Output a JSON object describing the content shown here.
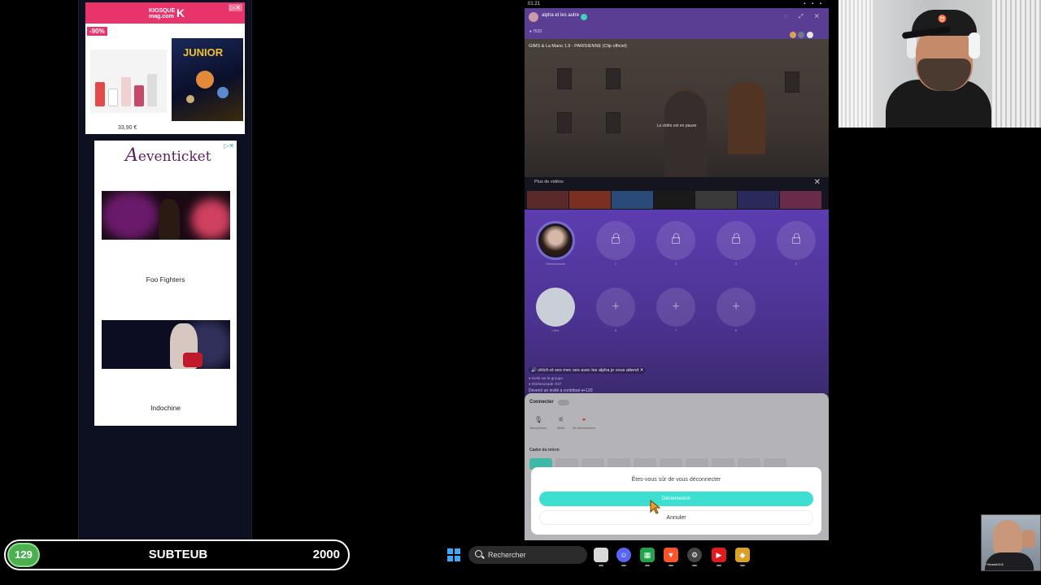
{
  "ads": {
    "kiosque": {
      "brand_line1": "KIOSQUE",
      "brand_line2": "mag.com",
      "discount": "-90%",
      "magazine_title": "JUNIOR",
      "price": "33,90 €",
      "ad_marker": "▷✕"
    },
    "eventicket": {
      "logo_initial": "A",
      "logo_text": "eventicket",
      "ad_marker": "▷✕",
      "events": [
        {
          "name": "Foo Fighters"
        },
        {
          "name": "Indochine"
        }
      ]
    }
  },
  "app": {
    "clock": "01:21",
    "system_icons": "▪ ▪ ▪",
    "room": {
      "owner_name": "alpha et les autre",
      "fans": "♦ 7533",
      "controls": "◌ ⤢ ✕",
      "header_avatar_colors": [
        "#d7a64a",
        "#6b7b8c",
        "#e6e6e6"
      ]
    },
    "video": {
      "title": "GIMS & La Mano 1.9 - PARISIENNE (Clip officiel)",
      "paused_text": "La vidéo est en pause"
    },
    "more_videos": {
      "label": "Plus de vidéos",
      "close": "✕",
      "thumb_colors": [
        "#5a2a2a",
        "#7a3020",
        "#2a4a7a",
        "#1a1a1a",
        "#3a3a3a",
        "#2a2a5a",
        "#6a2a4a"
      ]
    },
    "seats": {
      "host_label": "Sheherazade",
      "row1_numbers": [
        "1",
        "2",
        "3",
        "4"
      ],
      "row2_labels": [
        "Libre",
        "6",
        "7",
        "8"
      ]
    },
    "chat": {
      "message": "🔊 ohlch et ses mec ses avec les alpha je vous attend ✕",
      "sub1": "♦ Invité sur le groupe",
      "sub2": "♦ Sheherazade  ↺37",
      "contribution": "Devenir un invité a contribué ♦+120"
    },
    "settings_sheet": {
      "header": "Connecter",
      "options": [
        {
          "icon": "🎙",
          "label": "Microphone"
        },
        {
          "icon": "⚟",
          "label": "Mixer"
        },
        {
          "icon": "⚭",
          "label": "Se déconnecter"
        }
      ],
      "section_title": "Cadre du micro"
    },
    "confirm_dialog": {
      "question": "Êtes-vous sûr de vous déconnecter",
      "confirm_label": "Déconnexion",
      "cancel_label": "Annuler"
    }
  },
  "webcam_small": {
    "tag": "▪ RéussiteGr4l"
  },
  "sub_goal_bar": {
    "count": "129",
    "label": "SUBTEUB",
    "goal": "2000",
    "accent": "#4caf50"
  },
  "taskbar": {
    "search_label": "Rechercher",
    "apps": [
      {
        "icon": "file-explorer-icon",
        "color": "#d9d9d9"
      },
      {
        "icon": "discord-icon",
        "color": "#5865f2"
      },
      {
        "icon": "spreadsheet-icon",
        "color": "#22a34a"
      },
      {
        "icon": "brave-icon",
        "color": "#fb542b"
      },
      {
        "icon": "settings-gear-icon",
        "color": "#444444"
      },
      {
        "icon": "youtube-icon",
        "color": "#e01c1c"
      },
      {
        "icon": "streaming-app-icon",
        "color": "#d9a12a"
      }
    ]
  }
}
